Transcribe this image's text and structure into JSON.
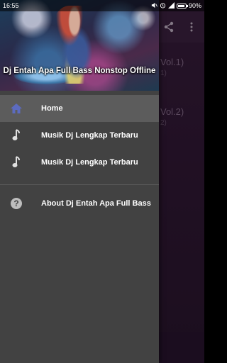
{
  "status_bar": {
    "time": "16:55",
    "battery_percent": "90%",
    "battery_level": 0.9
  },
  "app": {
    "list": [
      {
        "title": "Vol.1)",
        "subtitle": "1)"
      },
      {
        "title": "Vol.2)",
        "subtitle": "2)"
      }
    ],
    "actions": [
      "share-icon",
      "overflow-menu-icon"
    ]
  },
  "drawer": {
    "title": "Dj Entah Apa Full Bass Nonstop Offline",
    "items": [
      {
        "label": "Home",
        "icon": "home-icon",
        "active": true
      },
      {
        "label": "Musik Dj Lengkap Terbaru",
        "icon": "music-note-icon",
        "active": false
      },
      {
        "label": "Musik Dj Lengkap Terbaru",
        "icon": "music-note-icon",
        "active": false
      }
    ],
    "footer_items": [
      {
        "label": "About Dj Entah Apa Full Bass",
        "icon": "help-icon"
      }
    ]
  },
  "colors": {
    "drawer_bg": "#424242",
    "active_item_bg": "#5c5c5c",
    "home_icon": "#5c6bc0",
    "app_bg": "#3a1f3e"
  }
}
